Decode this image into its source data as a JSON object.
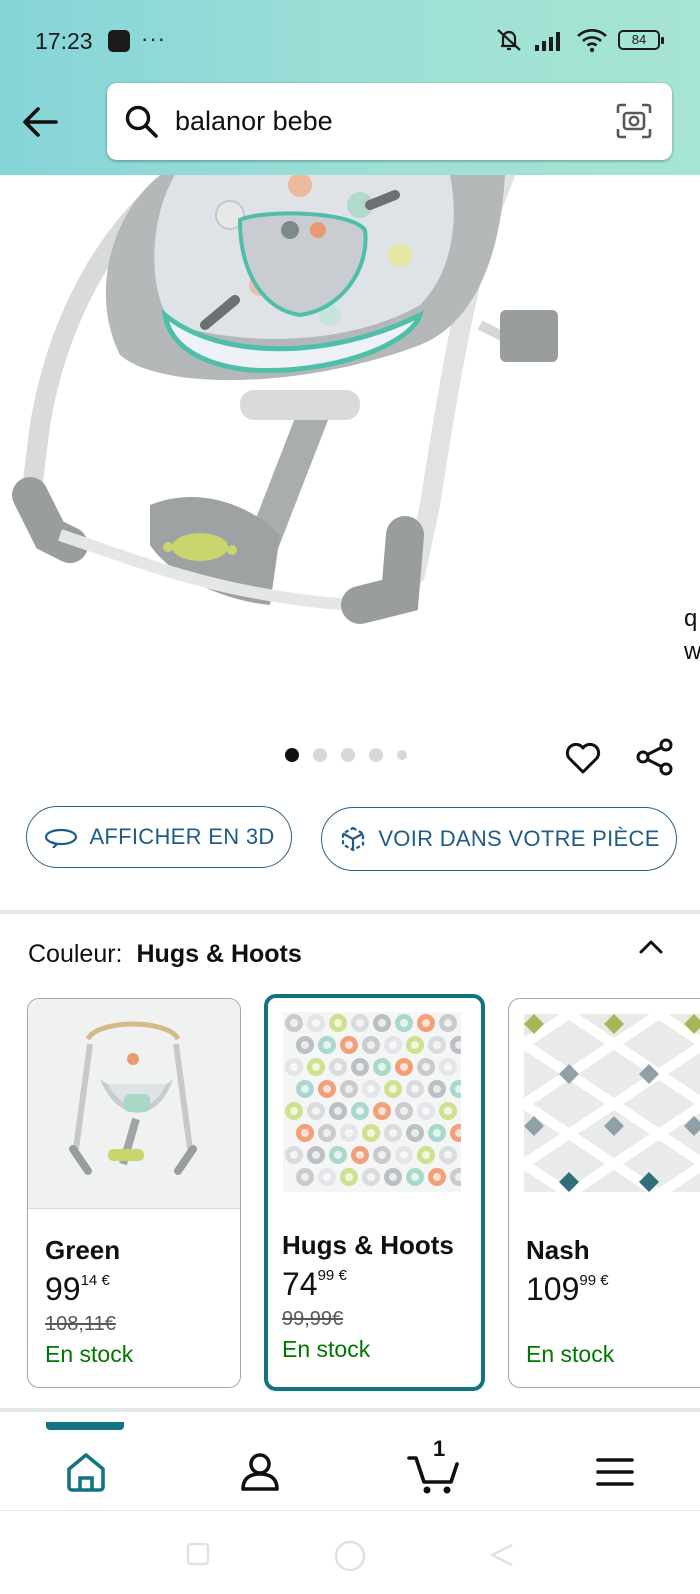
{
  "status_bar": {
    "time": "17:23",
    "dots": "···",
    "battery": "84"
  },
  "search": {
    "query": "balanor bebe"
  },
  "product_image": {
    "side_peek_text": [
      "q",
      "w"
    ]
  },
  "carousel": {
    "dot_count": 5,
    "active_index": 0
  },
  "actions": {
    "view_3d_label": "AFFICHER EN 3D",
    "view_room_label": "VOIR DANS VOTRE PIÈCE"
  },
  "color": {
    "label": "Couleur:",
    "selected": "Hugs & Hoots",
    "options": [
      {
        "name": "Green",
        "price_main": "99",
        "price_fraction": "14 €",
        "old_price": "108,11€",
        "stock": "En stock"
      },
      {
        "name": "Hugs & Hoots",
        "price_main": "74",
        "price_fraction": "99 €",
        "old_price": "99,99€",
        "stock": "En stock"
      },
      {
        "name": "Nash",
        "price_main": "109",
        "price_fraction": "99 €",
        "old_price": "",
        "stock": "En stock"
      }
    ]
  },
  "bottom_nav": {
    "cart_count": "1",
    "accent_color": "#127481"
  },
  "colors": {
    "header_gradient_start": "#85d4d8",
    "header_gradient_end": "#a6e5d3",
    "link_blue": "#1f5c85",
    "in_stock_green": "#007600"
  }
}
